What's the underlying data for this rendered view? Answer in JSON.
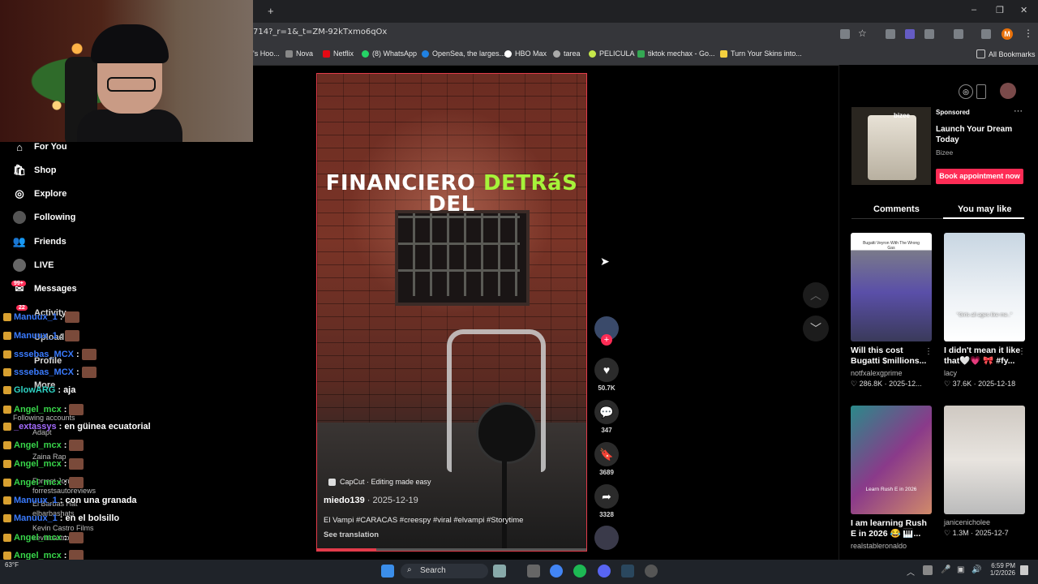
{
  "browser": {
    "url": "714?_r=1&_t=ZM-92kTxmo6qOx",
    "new_tab": "+",
    "window_controls": {
      "minimize": "–",
      "restore": "❐",
      "close": "✕"
    },
    "profile_initial": "M",
    "bookmarks": [
      "'s Hoo...",
      "Nova",
      "Netflix",
      "(8) WhatsApp",
      "OpenSea, the larges...",
      "HBO Max",
      "tarea",
      "PELICULA",
      "tiktok mechax - Go...",
      "Turn Your Skins into..."
    ],
    "all_bookmarks": "All Bookmarks"
  },
  "sidebar": {
    "items": [
      {
        "label": "For You",
        "icon": "home-icon"
      },
      {
        "label": "Shop",
        "icon": "shop-icon"
      },
      {
        "label": "Explore",
        "icon": "compass-icon"
      },
      {
        "label": "Following",
        "icon": "avatar-icon"
      },
      {
        "label": "Friends",
        "icon": "friends-icon"
      },
      {
        "label": "LIVE",
        "icon": "live-icon"
      },
      {
        "label": "Messages",
        "icon": "messages-icon",
        "badge": "99+"
      },
      {
        "label": "Activity",
        "icon": "activity-icon",
        "badge": "22"
      },
      {
        "label": "Upload",
        "icon": "upload-icon"
      },
      {
        "label": "Profile",
        "icon": "profile-icon"
      },
      {
        "label": "More",
        "icon": "more-icon"
      }
    ],
    "following_accounts_heading": "Following accounts",
    "accounts": [
      "Adapt",
      "Zaina Rap",
      "Forrest Jones",
      "forrestsautoreviews",
      "El Barbas Hat",
      "elbarbashats",
      "Kevin Castro Films",
      "kevincastrofilm"
    ]
  },
  "chat": [
    {
      "user": "Manuux_1",
      "msg": "",
      "color": "blue"
    },
    {
      "user": "Manuux_1",
      "msg": "",
      "color": "blue"
    },
    {
      "user": "sssebas_MCX",
      "msg": "",
      "color": "blue"
    },
    {
      "user": "sssebas_MCX",
      "msg": "",
      "color": "blue"
    },
    {
      "user": "GlowARG",
      "msg": ": aja",
      "color": "teal"
    },
    {
      "user": "Angel_mcx",
      "msg": "",
      "color": "green"
    },
    {
      "user": "_extassys",
      "msg": ": en güinea ecuatorial",
      "color": "purple"
    },
    {
      "user": "Angel_mcx",
      "msg": "",
      "color": "green"
    },
    {
      "user": "Angel_mcx",
      "msg": "",
      "color": "green"
    },
    {
      "user": "Angel_mcx",
      "msg": "",
      "color": "green"
    },
    {
      "user": "Manuux_1",
      "msg": ": con una granada",
      "color": "blue"
    },
    {
      "user": "Manuux_1",
      "msg": ": en el bolsillo",
      "color": "blue"
    },
    {
      "user": "Angel_mcx",
      "msg": "",
      "color": "green"
    },
    {
      "user": "Angel_mcx",
      "msg": "",
      "color": "green"
    },
    {
      "user": "sssebas_MCX",
      "msg": "",
      "color": "blue"
    }
  ],
  "video": {
    "title_white_1": "FINANCIERO ",
    "title_green": "DETRáS",
    "title_white_2": "DEL",
    "capcut": "CapCut · Editing made easy",
    "author": "miedo139",
    "date": " · 2025-12-19",
    "description": "El Vampi #CARACAS #creespy #viral #elvampi #Storytime",
    "see_translation": "See translation",
    "progress": 0.22
  },
  "actions": {
    "likes": "50.7K",
    "comments": "347",
    "saves": "3689",
    "shares": "3328"
  },
  "ad": {
    "sponsored": "Sponsored",
    "title": "Launch Your Dream Today",
    "brand": "Bizee",
    "cta": "Book appointment now",
    "thumb_text": "bizee"
  },
  "tabs": {
    "comments": "Comments",
    "you_may_like": "You may like"
  },
  "cards": [
    {
      "title": "Will this cost Bugatti $millions...",
      "author": "notfxalexgprime",
      "stats": "♡ 286.8K · 2025-12...",
      "thumb_caption": "Bugatti Veyron With The Wrong Gas"
    },
    {
      "title": "I didn't mean it like that🤍💗 🎀 #fy...",
      "author": "lacy",
      "stats": "♡ 37.6K · 2025-12-18",
      "thumb_caption": "\"Girls all ages like me..\""
    },
    {
      "title": "I am learning Rush E in 2026 😂 🎹...",
      "author": "realstableronaldo",
      "stats": "",
      "thumb_caption": "Learn Rush E in 2026"
    },
    {
      "title": "",
      "author": "janicenicholee",
      "stats": "♡ 1.3M · 2025-12-7",
      "thumb_caption": ""
    }
  ],
  "taskbar": {
    "search": "Search",
    "weather": "63°F",
    "time": "6:59 PM",
    "date": "1/2/2026"
  }
}
